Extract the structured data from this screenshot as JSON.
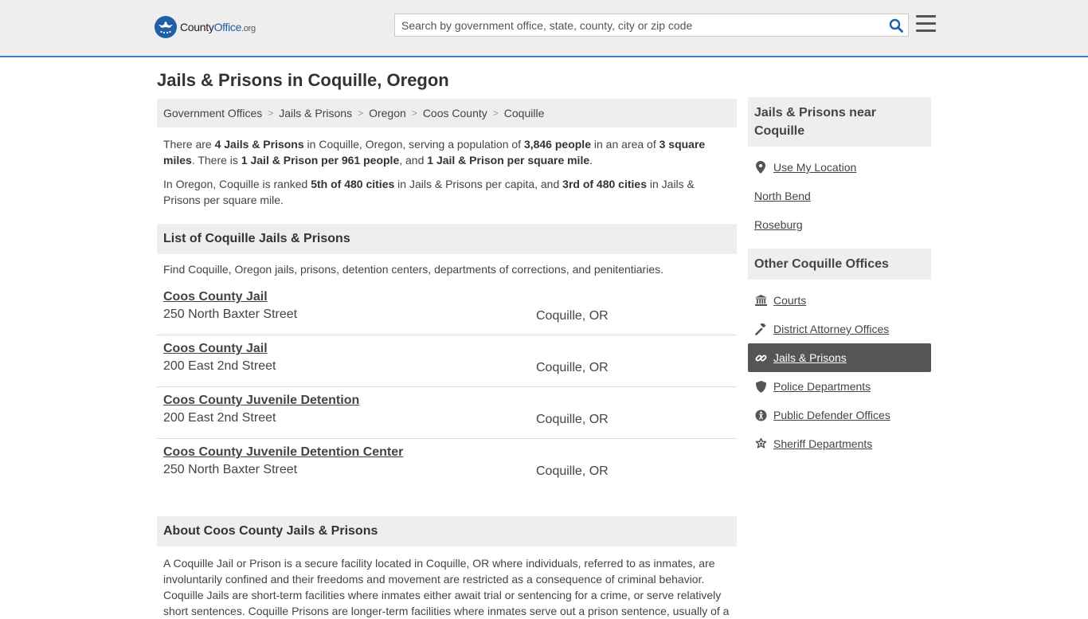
{
  "header": {
    "logo": {
      "brand_a": "County",
      "brand_b": "Office",
      "brand_c": ".org"
    },
    "search": {
      "placeholder": "Search by government office, state, county, city or zip code"
    }
  },
  "page": {
    "title": "Jails & Prisons in Coquille, Oregon"
  },
  "breadcrumb": [
    "Government Offices",
    "Jails & Prisons",
    "Oregon",
    "Coos County",
    "Coquille"
  ],
  "intro": {
    "p1": [
      "There are ",
      "4 Jails & Prisons",
      " in Coquille, Oregon, serving a population of ",
      "3,846 people",
      " in an area of ",
      "3 square miles",
      ". There is ",
      "1 Jail & Prison per 961 people",
      ", and ",
      "1 Jail & Prison per square mile",
      "."
    ],
    "p2": [
      "In Oregon, Coquille is ranked ",
      "5th of 480 cities",
      " in Jails & Prisons per capita, and ",
      "3rd of 480 cities",
      " in Jails & Prisons per square mile."
    ]
  },
  "list": {
    "heading": "List of Coquille Jails & Prisons",
    "intro": "Find Coquille, Oregon jails, prisons, detention centers, departments of corrections, and penitentiaries.",
    "items": [
      {
        "name": "Coos County Jail",
        "address": "250 North Baxter Street",
        "city": "Coquille, OR"
      },
      {
        "name": "Coos County Jail",
        "address": "200 East 2nd Street",
        "city": "Coquille, OR"
      },
      {
        "name": "Coos County Juvenile Detention",
        "address": "200 East 2nd Street",
        "city": "Coquille, OR"
      },
      {
        "name": "Coos County Juvenile Detention Center",
        "address": "250 North Baxter Street",
        "city": "Coquille, OR"
      }
    ]
  },
  "about": {
    "heading": "About Coos County Jails & Prisons",
    "text": "A Coquille Jail or Prison is a secure facility located in Coquille, OR where individuals, referred to as inmates, are involuntarily confined and their freedoms and movement are restricted as a consequence of criminal behavior. Coquille Jails are short-term facilities where inmates either await trial or sentencing for a crime, or serve relatively short sentences. Coquille Prisons are longer-term facilities where inmates serve out a prison sentence, usually of a"
  },
  "sidebar": {
    "nearby_heading": "Jails & Prisons near Coquille",
    "nearby": [
      {
        "label": "Use My Location",
        "icon": "map-pin-icon"
      },
      {
        "label": "North Bend"
      },
      {
        "label": "Roseburg"
      }
    ],
    "other_heading": "Other Coquille Offices",
    "others": [
      {
        "label": "Courts",
        "icon": "courthouse-icon"
      },
      {
        "label": "District Attorney Offices",
        "icon": "gavel-icon"
      },
      {
        "label": "Jails & Prisons",
        "icon": "chain-link-icon",
        "active": true
      },
      {
        "label": "Police Departments",
        "icon": "shield-icon"
      },
      {
        "label": "Public Defender Offices",
        "icon": "accessibility-icon"
      },
      {
        "label": "Sheriff Departments",
        "icon": "star-badge-icon"
      }
    ]
  },
  "colors": {
    "accent": "#3b7fc4",
    "brand": "#1f5fa6",
    "active_bg": "#555555"
  }
}
